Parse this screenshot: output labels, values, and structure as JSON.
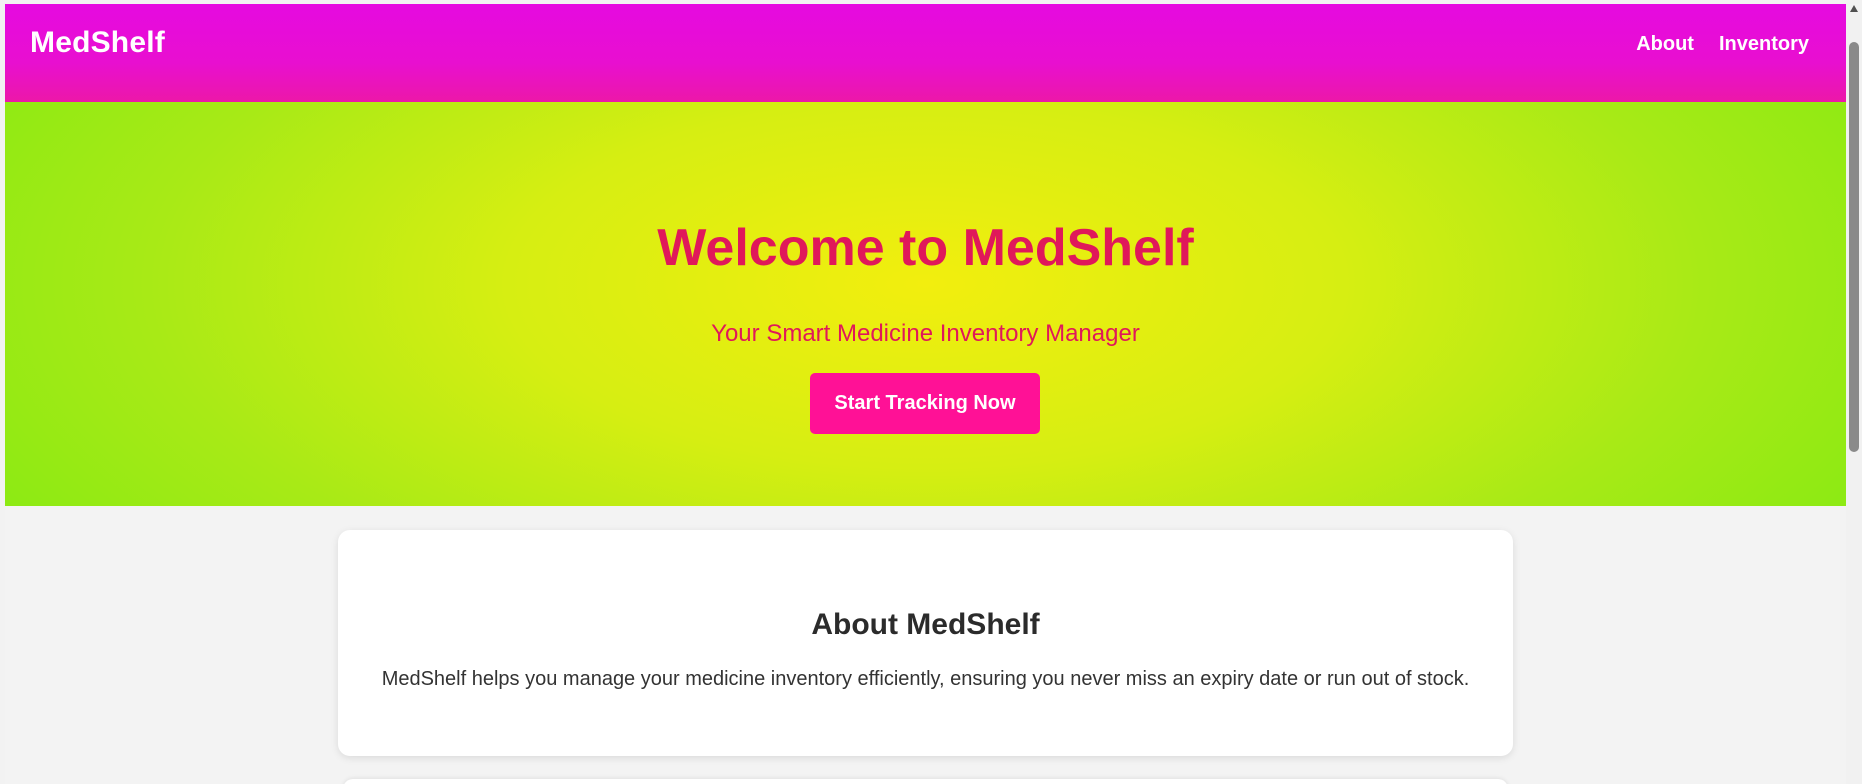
{
  "navbar": {
    "brand": "MedShelf",
    "links": [
      {
        "label": "About"
      },
      {
        "label": "Inventory"
      }
    ]
  },
  "hero": {
    "title": "Welcome to MedShelf",
    "subtitle": "Your Smart Medicine Inventory Manager",
    "cta_label": "Start Tracking Now"
  },
  "about": {
    "title": "About MedShelf",
    "text": "MedShelf helps you manage your medicine inventory efficiently, ensuring you never miss an expiry date or run out of stock."
  },
  "colors": {
    "navbar": "#e60ae0",
    "hero_center": "#f2ee0e",
    "hero_edge": "#7eea12",
    "accent_text": "#e0185a",
    "cta_background": "#ff1196"
  },
  "icons": {
    "scroll_up": "scroll-up-arrow-icon"
  }
}
